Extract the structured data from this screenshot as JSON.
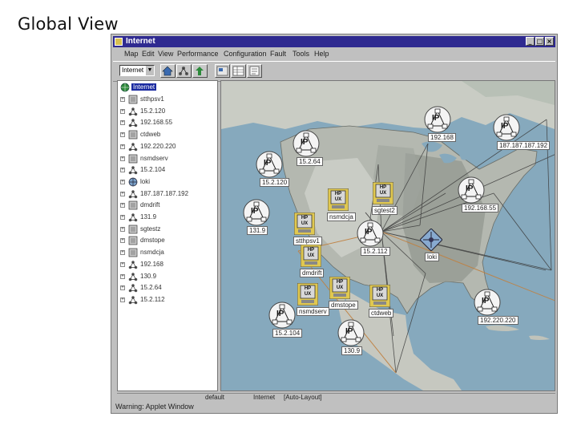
{
  "slide": {
    "title": "Global View"
  },
  "window": {
    "title": "Internet",
    "menu": [
      "Map",
      "Edit",
      "View",
      "Performance",
      "Configuration",
      "Fault",
      "Tools",
      "Help"
    ]
  },
  "toolbar": {
    "submap_combo": "Internet"
  },
  "tree": {
    "root": "Internet",
    "items": [
      {
        "label": "stthpsv1",
        "icon": "server-icon"
      },
      {
        "label": "15.2.120",
        "icon": "network-icon"
      },
      {
        "label": "192.168.55",
        "icon": "network-icon"
      },
      {
        "label": "ctdweb",
        "icon": "server-icon"
      },
      {
        "label": "192.220.220",
        "icon": "network-icon"
      },
      {
        "label": "nsmdserv",
        "icon": "server-icon"
      },
      {
        "label": "15.2.104",
        "icon": "network-icon"
      },
      {
        "label": "loki",
        "icon": "gateway-icon"
      },
      {
        "label": "187.187.187.192",
        "icon": "network-icon"
      },
      {
        "label": "dmdrift",
        "icon": "server-icon"
      },
      {
        "label": "131.9",
        "icon": "network-icon"
      },
      {
        "label": "sgtestz",
        "icon": "server-icon"
      },
      {
        "label": "dmstope",
        "icon": "server-icon"
      },
      {
        "label": "nsmdcja",
        "icon": "server-icon"
      },
      {
        "label": "192.168",
        "icon": "network-icon"
      },
      {
        "label": "130.9",
        "icon": "network-icon"
      },
      {
        "label": "15.2.64",
        "icon": "network-icon"
      },
      {
        "label": "15.2.112",
        "icon": "network-icon"
      }
    ]
  },
  "map": {
    "ip_nodes": [
      {
        "label": "15.2.64",
        "symbol": "IP"
      },
      {
        "label": "192.168",
        "symbol": "IP"
      },
      {
        "label": "187.187.187.192",
        "symbol": "IP"
      },
      {
        "label": "15.2.120",
        "symbol": "IP"
      },
      {
        "label": "131.9",
        "symbol": "IP"
      },
      {
        "label": "192.168.55",
        "symbol": "IP"
      },
      {
        "label": "15.2.112",
        "symbol": "IP"
      },
      {
        "label": "15.2.104",
        "symbol": "IP"
      },
      {
        "label": "192.220.220",
        "symbol": "IP"
      },
      {
        "label": "130.9",
        "symbol": "IP"
      }
    ],
    "hpux_nodes": [
      {
        "label": "nsmdcja",
        "symbol": "HP UX"
      },
      {
        "label": "sgtest2",
        "symbol": "HP UX"
      },
      {
        "label": "stthpsv1",
        "symbol": "HP UX"
      },
      {
        "label": "dmdrift",
        "symbol": "HP UX"
      },
      {
        "label": "nsmdserv",
        "symbol": "HP UX"
      },
      {
        "label": "dmstope",
        "symbol": "HP UX"
      },
      {
        "label": "ctdweb",
        "symbol": "HP UX"
      }
    ],
    "gateway": {
      "label": "loki"
    }
  },
  "status": {
    "map_name": "default",
    "submap": "Internet",
    "layout": "[Auto-Layout]"
  },
  "applet_warning": "Warning: Applet Window"
}
